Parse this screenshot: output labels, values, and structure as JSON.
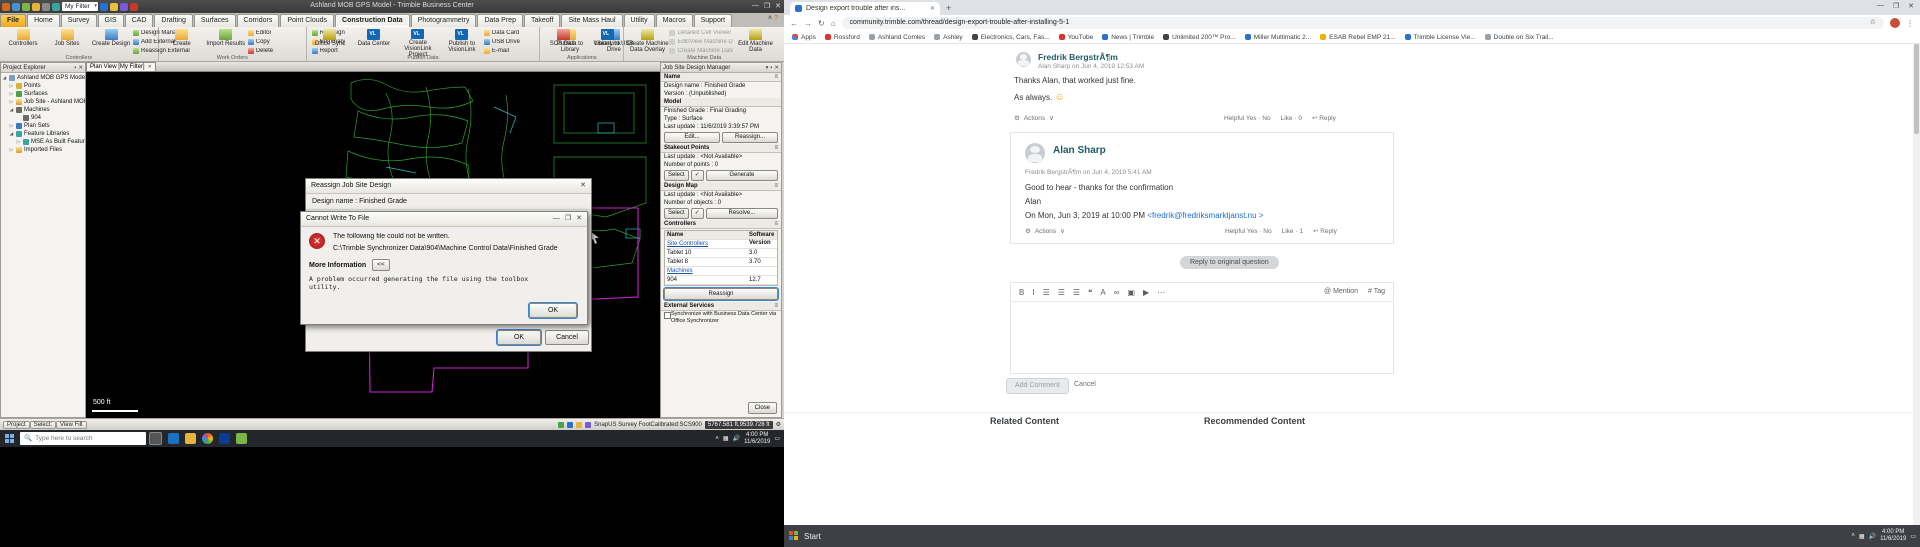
{
  "tbc": {
    "title": "Ashland MOB GPS Model - Trimble Business Center",
    "qat_filter_label": "My Filter",
    "window_controls": {
      "minimize": "—",
      "maximize": "❐",
      "close": "✕"
    },
    "ribbon_help": {
      "collapse": "˄",
      "help": "?"
    },
    "tabs": [
      {
        "label": "File",
        "cls": "file"
      },
      {
        "label": "Home"
      },
      {
        "label": "Survey"
      },
      {
        "label": "GIS"
      },
      {
        "label": "CAD"
      },
      {
        "label": "Drafting"
      },
      {
        "label": "Surfaces"
      },
      {
        "label": "Corridors"
      },
      {
        "label": "Point Clouds"
      },
      {
        "label": "Construction Data",
        "cls": "active"
      },
      {
        "label": "Photogrammetry"
      },
      {
        "label": "Data Prep"
      },
      {
        "label": "Takeoff"
      },
      {
        "label": "Site Mass Haul"
      },
      {
        "label": "Utility"
      },
      {
        "label": "Macros"
      },
      {
        "label": "Support"
      }
    ],
    "ribbon": {
      "groups": [
        {
          "label": "Controllers",
          "items": [
            {
              "label": "Controllers",
              "cls": "big i-y"
            },
            {
              "label": "Job Sites",
              "cls": "big i-y"
            },
            {
              "label": "Create Design",
              "cls": "big i-b"
            },
            {
              "label": "Design Manager",
              "cls": "small i-g"
            },
            {
              "label": "Add External",
              "cls": "small i-b"
            },
            {
              "label": "Reassign External",
              "cls": "small i-g"
            }
          ]
        },
        {
          "label": "Work Orders",
          "items": [
            {
              "label": "Create",
              "cls": "big i-y"
            },
            {
              "label": "Import Results",
              "cls": "big i-g"
            },
            {
              "label": "Editor",
              "cls": "small i-y"
            },
            {
              "label": "Copy",
              "cls": "small i-b"
            },
            {
              "label": "Delete",
              "cls": "small i-r"
            },
            {
              "label": "Reassign",
              "cls": "small i-g"
            },
            {
              "label": "Summary",
              "cls": "small i-y"
            },
            {
              "label": "Report",
              "cls": "small i-b"
            }
          ]
        },
        {
          "label": "Publish Data",
          "items": [
            {
              "label": "Office Sync",
              "cls": "big i-k"
            },
            {
              "label": "Data Center",
              "cls": "big i-vl"
            },
            {
              "label": "Create VisionLink Project",
              "cls": "big i-vl"
            },
            {
              "label": "Publish to VisionLink",
              "cls": "big i-vl"
            },
            {
              "label": "Data Card",
              "cls": "small i-y"
            },
            {
              "label": "USB Drive",
              "cls": "small i-b"
            },
            {
              "label": "E-mail",
              "cls": "small i-y"
            },
            {
              "label": "Publish to Library",
              "cls": "big i-y"
            },
            {
              "label": "Library to USB Drive",
              "cls": "big i-b"
            }
          ]
        },
        {
          "label": "Applications",
          "items": [
            {
              "label": "SCS Data",
              "cls": "big i-r"
            },
            {
              "label": "VisionLink",
              "cls": "big i-vl"
            }
          ]
        },
        {
          "label": "Machine Data",
          "items": [
            {
              "label": "Create Machine Data Overlay",
              "cls": "big i-k"
            },
            {
              "label": "Detailed Cell Viewer",
              "cls": "small disabled i-gray"
            },
            {
              "label": "Edit/View Machine Data Overlay",
              "cls": "small disabled i-gray"
            },
            {
              "label": "Create Machine Data Surface",
              "cls": "small disabled i-gray"
            },
            {
              "label": "Edit Machine Data",
              "cls": "big i-k"
            }
          ]
        }
      ]
    },
    "project_explorer": {
      "title": "Project Explorer",
      "pin": "▪",
      "close": "✕",
      "tree": [
        {
          "label": "Ashland MOB GPS Model",
          "cls": "d0 t-root",
          "exp": "◢"
        },
        {
          "label": "Points",
          "cls": "d1 t-pts",
          "exp": "▷"
        },
        {
          "label": "Surfaces",
          "cls": "d1 t-sur",
          "exp": "▷"
        },
        {
          "label": "Job Site - Ashland MOB",
          "cls": "d1 t-fold",
          "exp": "▷"
        },
        {
          "label": "Machines",
          "cls": "d1 t-mach",
          "exp": "◢"
        },
        {
          "label": "904",
          "cls": "d2 t-mach",
          "exp": ""
        },
        {
          "label": "Plan Sets",
          "cls": "d1 t-plan",
          "exp": "▷"
        },
        {
          "label": "Feature Libraries",
          "cls": "d1 t-feat",
          "exp": "◢"
        },
        {
          "label": "MSE As Built Features",
          "cls": "d2 t-feat",
          "exp": "▷"
        },
        {
          "label": "Imported Files",
          "cls": "d1 t-fold",
          "exp": "▷"
        }
      ]
    },
    "view_tab": {
      "label": "Plan View [My Filter]",
      "close": "✕"
    },
    "cad": {
      "scale_label": "500 ft"
    },
    "design_manager": {
      "title": "Job Site Design Manager",
      "menu": "▾",
      "pin": "▪",
      "close": "✕",
      "name_header": "Name",
      "name_rows": [
        "Design name : Finished Grade",
        "Version : (Unpublished)"
      ],
      "model_header": "Model",
      "model_rows": [
        "Finished Grade : Final Grading",
        "Type : Surface",
        "Last update : 11/6/2019 3:39:57 PM"
      ],
      "model_buttons": {
        "edit": "Edit...",
        "reassign": "Reassign..."
      },
      "stakeout_header": "Stakeout Points",
      "stakeout_rows": [
        "Last update : <Not Available>",
        "Number of points : 0"
      ],
      "stakeout_buttons": {
        "select": "Select",
        "mid": "✓",
        "generate": "Generate"
      },
      "map_header": "Design Map",
      "map_rows": [
        "Last update : <Not Available>",
        "Number of objects : 0"
      ],
      "map_buttons": {
        "select": "Select",
        "mid": "✓",
        "resolve": "Resolve..."
      },
      "controllers_header": "Controllers",
      "controllers_table": {
        "col_name": "Name",
        "col_version": "Software Version",
        "rows": [
          {
            "name": "Site Controllers",
            "ver": "",
            "cls": "cgroup"
          },
          {
            "name": "Tablet 10",
            "ver": "3.0"
          },
          {
            "name": "Tablet 8",
            "ver": "3.70"
          },
          {
            "name": "Machines",
            "ver": "",
            "cls": "cgroup"
          },
          {
            "name": "904",
            "ver": "12.7"
          }
        ]
      },
      "reassign_button": "Reassign",
      "external_header": "External Services",
      "external_text": "Synchronize with Business Data Center via Office Synchronizer",
      "close_button": "Close"
    },
    "status_bar": {
      "chips": [
        {
          "label": "Project"
        },
        {
          "label": "Select:"
        },
        {
          "label": "View Filt"
        }
      ],
      "labels": [
        {
          "label": "Snap"
        },
        {
          "label": "US Survey Foot"
        },
        {
          "label": "Calibrated:"
        },
        {
          "label": "SCS900"
        }
      ],
      "coords": "5767.581 ft,9539.728 ft",
      "gear": "⚙"
    }
  },
  "dialogs": {
    "reassign": {
      "title": "Reassign Job Site Design",
      "close": "✕",
      "design_row": "Design name : Finished Grade",
      "ok": "OK",
      "cancel": "Cancel"
    },
    "error": {
      "title": "Cannot Write To File",
      "controls": {
        "minimize": "—",
        "maximize": "❐",
        "close": "✕"
      },
      "icon_glyph": "✕",
      "message": "The following file could not be written.",
      "path": "C:\\Trimble Synchronizer Data\\904\\Machine Control Data\\Finished Grade",
      "more_info_label": "More Information",
      "more_info_toggle": "<<",
      "details": "A problem occurred generating the file using the toolbox utility.",
      "ok": "OK"
    }
  },
  "browser": {
    "tab": {
      "title": "Design export trouble after ins...",
      "close": "✕"
    },
    "new_tab": "+",
    "window_controls": {
      "minimize": "—",
      "maximize": "❐",
      "close": "✕"
    },
    "nav": {
      "back": "←",
      "forward": "→",
      "reload": "↻",
      "home": "⌂"
    },
    "url": "community.trimble.com/thread/design-export-trouble-after-installing-5-1",
    "star": "☆",
    "menu": "⋮",
    "bookmarks": [
      {
        "label": "Apps",
        "cls": "c-grid"
      },
      {
        "label": "Rossford",
        "cls": "c-red"
      },
      {
        "label": "Ashland Comles"
      },
      {
        "label": "Ashley"
      },
      {
        "label": "Electronics, Cars, Fas...",
        "cls": "c-dark"
      },
      {
        "label": "YouTube",
        "cls": "c-red"
      },
      {
        "label": "News | Trimble",
        "cls": "c-blue"
      },
      {
        "label": "Unlimited 200™ Pro...",
        "cls": "c-dark"
      },
      {
        "label": "Miller Multimatic 2...",
        "cls": "c-blue"
      },
      {
        "label": "ESAB Rebel EMP 21...",
        "cls": "c-yellow"
      },
      {
        "label": "Trimble License Vie...",
        "cls": "c-blue"
      },
      {
        "label": "Double on Six Trail..."
      }
    ],
    "post1": {
      "author": "Fredrik BergstrÃ¶m",
      "meta": "Alan Sharp on Jun 4, 2019 12:53 AM",
      "line1": "Thanks Alan, that worked just fine.",
      "line2": "As always.",
      "emoji": "☺",
      "actions": "Actions",
      "actions_caret": "∨",
      "helpful": "Helpful  Yes · No",
      "like": "Like · 0",
      "reply": "Reply",
      "reply_icon": "↩"
    },
    "post2": {
      "author": "Alan Sharp",
      "meta": "Fredrik BergstrÃ¶m on Jun 4, 2019 5:41 AM",
      "line1": "Good to hear - thanks for the confirmation",
      "line2": "Alan",
      "quote_prefix": "On Mon, Jun 3, 2019 at 10:00 PM ",
      "quote_link": "<fredrik@fredriksmarktjanst.nu >",
      "actions": "Actions",
      "actions_caret": "∨",
      "helpful": "Helpful  Yes · No",
      "like": "Like · 1",
      "reply": "Reply",
      "reply_icon": "↩"
    },
    "reply_pill": "Reply to original question",
    "composer": {
      "tools": [
        {
          "label": "B"
        },
        {
          "label": "I"
        },
        {
          "label": "☰"
        },
        {
          "label": "☰"
        },
        {
          "label": "☰"
        },
        {
          "label": "❝"
        },
        {
          "label": "A"
        },
        {
          "label": "∞"
        },
        {
          "label": "▣"
        },
        {
          "label": "▶"
        },
        {
          "label": "⋯"
        }
      ],
      "mention_icon": "@",
      "mention": "Mention",
      "tag_icon": "#",
      "tag": "Tag",
      "add_button": "Add Comment",
      "cancel_button": "Cancel"
    },
    "footer": {
      "related": "Related Content",
      "recommended": "Recommended Content"
    }
  },
  "taskbar_left": {
    "search_placeholder": "Type here to search",
    "time": "4:00 PM",
    "date": "11/6/2019"
  },
  "taskbar_right": {
    "start": "Start",
    "time": "4:00 PM",
    "date": "11/6/2019"
  }
}
